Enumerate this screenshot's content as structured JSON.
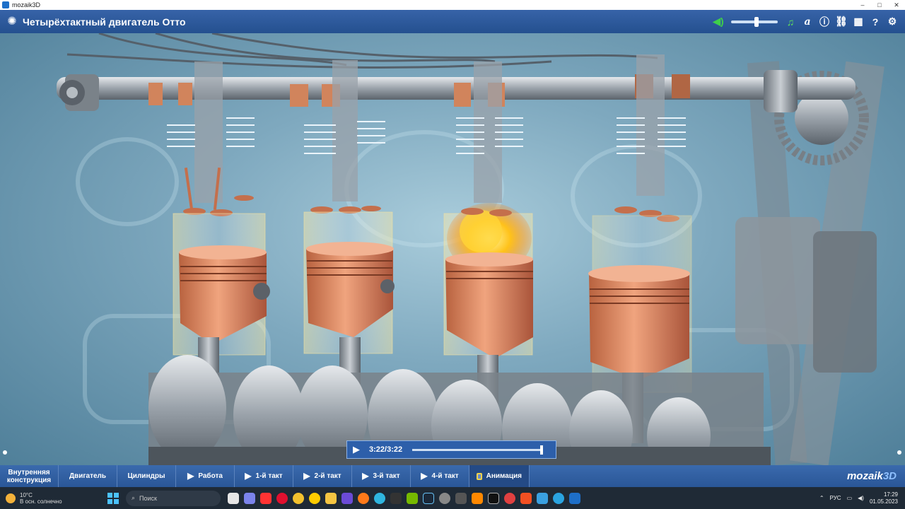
{
  "window": {
    "app_name": "mozaik3D",
    "controls": [
      "–",
      "□",
      "✕"
    ]
  },
  "header": {
    "title": "Четырёхтактный двигатель Отто",
    "icons": [
      "speaker-icon",
      "music-note-icon",
      "font-icon",
      "info-icon",
      "link-icon",
      "grid-icon",
      "help-icon",
      "gear-icon"
    ],
    "volume_level": 0.5
  },
  "player": {
    "time": "3:22/3:22",
    "progress": 1.0
  },
  "bottom_nav": {
    "items": [
      {
        "label": "Внутренняя конструкция",
        "has_play": false
      },
      {
        "label": "Двигатель",
        "has_play": false
      },
      {
        "label": "Цилиндры",
        "has_play": false
      },
      {
        "label": "Работа",
        "has_play": true
      },
      {
        "label": "1-й такт",
        "has_play": true
      },
      {
        "label": "2-й такт",
        "has_play": true
      },
      {
        "label": "3-й такт",
        "has_play": true
      },
      {
        "label": "4-й такт",
        "has_play": true
      },
      {
        "label": "Анимация",
        "has_play": false,
        "active": true
      }
    ],
    "brand": "mozaik",
    "brand_suffix": "3D"
  },
  "taskbar": {
    "weather_temp": "10°C",
    "weather_desc": "В осн. солнечно",
    "search_placeholder": "Поиск",
    "lang": "РУС",
    "time": "17:29",
    "date": "01.05.2023"
  },
  "colors": {
    "header_bg": "#2d5a9c",
    "nav_bg": "#2f5c9d",
    "accent": "#4cc2ff",
    "copper": "#c97a55"
  }
}
